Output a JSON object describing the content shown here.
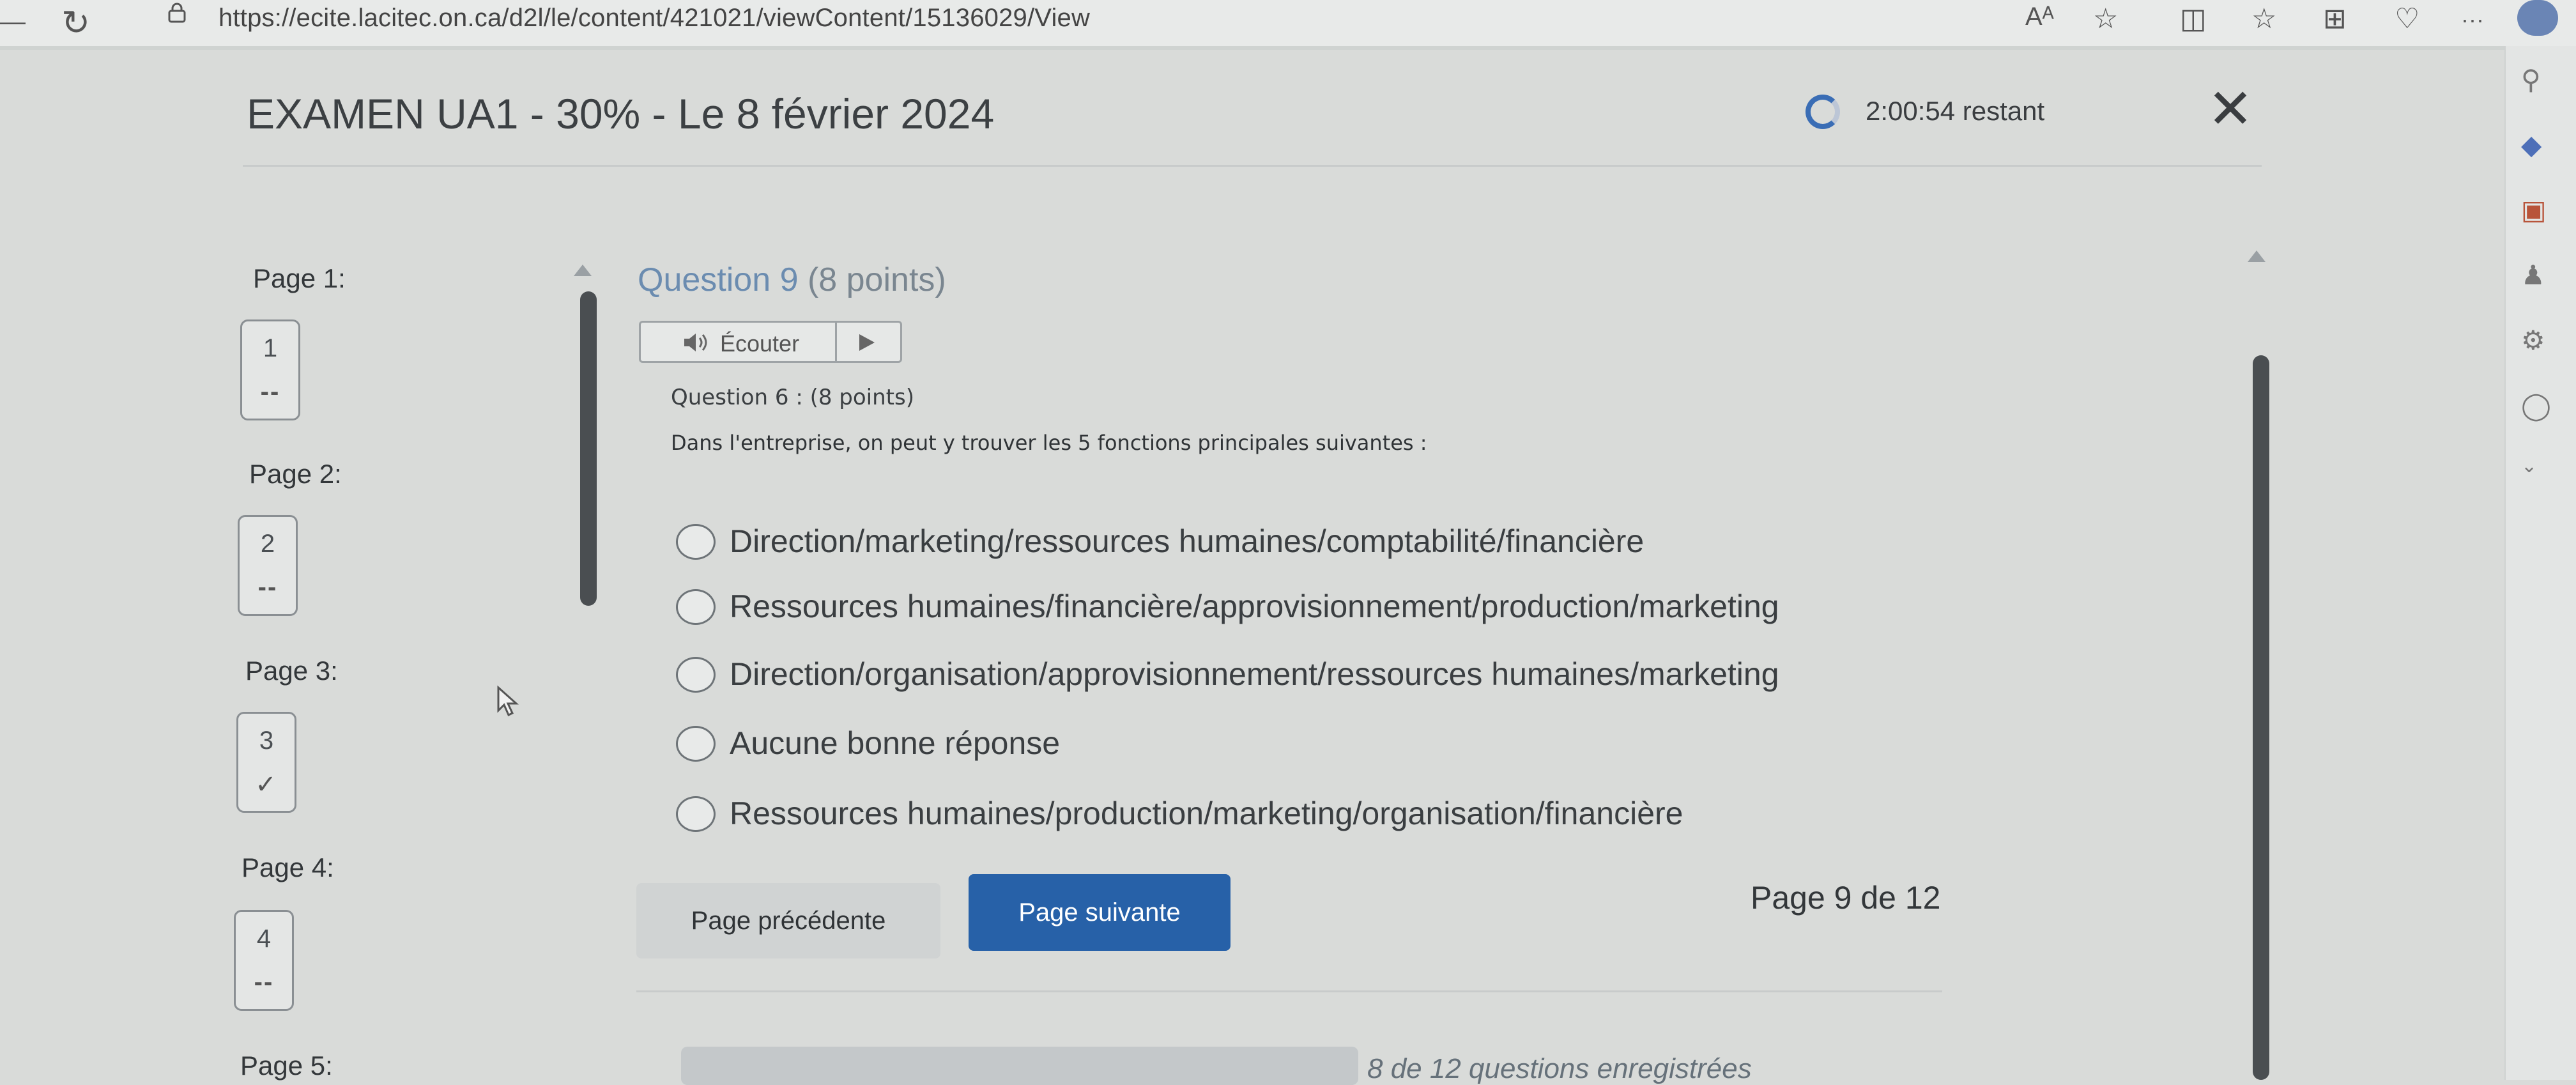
{
  "browser": {
    "url": "https://ecite.lacitec.on.ca/d2l/le/content/421021/viewContent/15136029/View",
    "read_aloud_label": "Aᴬ",
    "toolbar_icons": [
      "read-aloud-icon",
      "favorite-star-icon",
      "split-screen-icon",
      "favorites-list-icon",
      "collections-icon",
      "extensions-icon",
      "more-icon"
    ],
    "more_label": "···"
  },
  "quiz": {
    "title": "EXAMEN UA1 - 30% - Le 8 février 2024",
    "timer": "2:00:54 restant",
    "close_label": "✕"
  },
  "nav": {
    "pages": [
      {
        "label": "Page 1:",
        "number": "1",
        "state": "--"
      },
      {
        "label": "Page 2:",
        "number": "2",
        "state": "--"
      },
      {
        "label": "Page 3:",
        "number": "3",
        "state": "✓"
      },
      {
        "label": "Page 4:",
        "number": "4",
        "state": "--"
      },
      {
        "label": "Page 5:"
      }
    ]
  },
  "question": {
    "heading": "Question 9",
    "points": "(8 points)",
    "listen_label": "Écouter",
    "sub_heading": "Question 6 : (8 points)",
    "stem": "Dans l'entreprise, on peut y trouver les 5 fonctions principales suivantes :",
    "options": [
      "Direction/marketing/ressources humaines/comptabilité/financière",
      "Ressources humaines/financière/approvisionnement/production/marketing",
      "Direction/organisation/approvisionnement/ressources humaines/marketing",
      "Aucune bonne réponse",
      "Ressources humaines/production/marketing/organisation/financière"
    ]
  },
  "footer": {
    "prev_label": "Page précédente",
    "next_label": "Page suivante",
    "page_indicator": "Page 9 de 12",
    "saved_text": "8 de 12 questions enregistrées"
  },
  "colors": {
    "accent": "#2761a8",
    "question_heading": "#6b8cb0",
    "background": "#d9dbd9"
  }
}
